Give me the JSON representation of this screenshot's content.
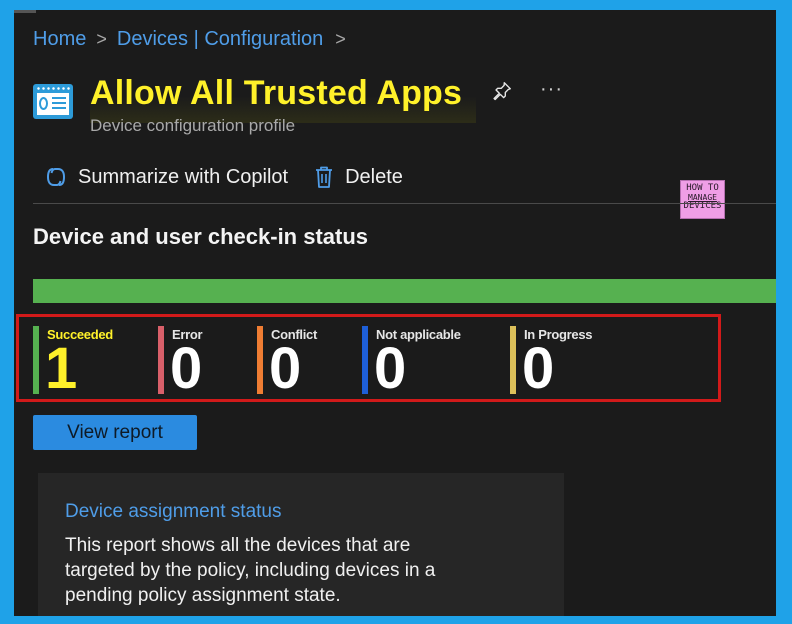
{
  "breadcrumb": {
    "items": [
      "Home",
      "Devices | Configuration"
    ],
    "sep": ">"
  },
  "header": {
    "title": "Allow All Trusted Apps",
    "subtitle": "Device configuration profile",
    "more": "···"
  },
  "toolbar": {
    "summarize_label": "Summarize with Copilot",
    "delete_label": "Delete"
  },
  "logo": {
    "line1": "HOW TO",
    "line2": "MANAGE",
    "line3": "DEVICES"
  },
  "checkin": {
    "title": "Device and user check-in status",
    "stats": [
      {
        "label": "Succeeded",
        "value": "1",
        "color": "#56b150"
      },
      {
        "label": "Error",
        "value": "0",
        "color": "#d9606a"
      },
      {
        "label": "Conflict",
        "value": "0",
        "color": "#ef7d33"
      },
      {
        "label": "Not applicable",
        "value": "0",
        "color": "#1e5fd8"
      },
      {
        "label": "In Progress",
        "value": "0",
        "color": "#dcc05a"
      }
    ],
    "view_report_label": "View report"
  },
  "assignment_card": {
    "title": "Device assignment status",
    "description": "This report shows all the devices that are targeted by the policy, including devices in a pending policy assignment state."
  },
  "colors": {
    "accent": "#4f9de8",
    "title_highlight": "#fff12a",
    "bar": "#56b150",
    "frame": "#1fa2e8"
  }
}
